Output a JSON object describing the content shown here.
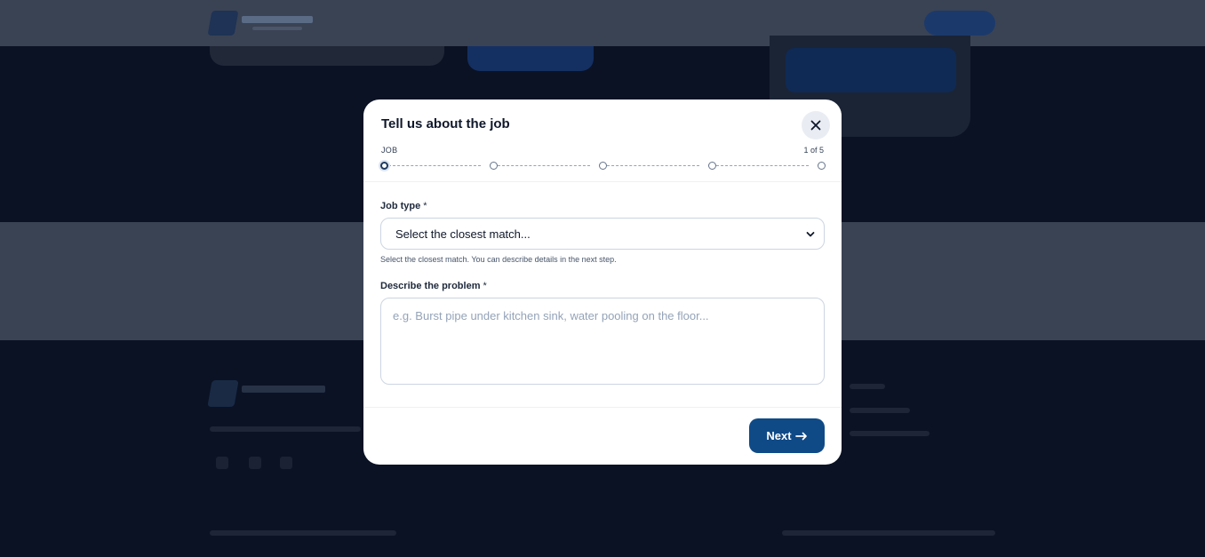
{
  "modal": {
    "title": "Tell us about the job",
    "step_label": "JOB",
    "step_count": "1 of 5",
    "total_steps": 5,
    "current_step": 1,
    "job_type": {
      "label": "Job type",
      "required_mark": "*",
      "selected": "Select the closest match...",
      "hint": "Select the closest match. You can describe details in the next step."
    },
    "problem": {
      "label": "Describe the problem",
      "required_mark": "*",
      "placeholder": "e.g. Burst pipe under kitchen sink, water pooling on the floor..."
    },
    "next_label": "Next",
    "icons": {
      "close": "close-icon",
      "next": "arrow-right-icon",
      "select": "chevron-down-icon"
    },
    "colors": {
      "primary": "#0f4a87",
      "overlay": "#0a1224"
    }
  }
}
